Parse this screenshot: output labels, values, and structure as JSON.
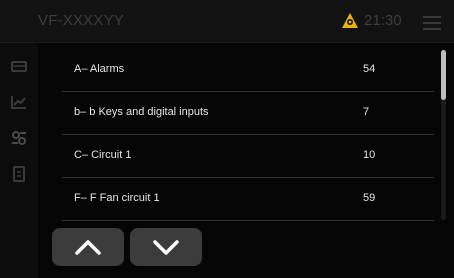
{
  "header": {
    "title": "VF-XXXXYY",
    "time": "21:30"
  },
  "icons": {
    "alarm": "alarm-warning-icon",
    "menu": "hamburger-menu-icon",
    "sidebar": [
      "monitor-icon",
      "chart-icon",
      "settings-icon",
      "document-icon"
    ],
    "up": "chevron-up-icon",
    "down": "chevron-down-icon"
  },
  "colors": {
    "alarm": "#e6b400",
    "text": "#e6e6e6",
    "button": "#3c3c3c"
  },
  "list": {
    "items": [
      {
        "label": "A– Alarms",
        "count": "54"
      },
      {
        "label": "b– b Keys and digital inputs",
        "count": "7"
      },
      {
        "label": "C– Circuit 1",
        "count": "10"
      },
      {
        "label": "F– F Fan circuit 1",
        "count": "59"
      }
    ]
  }
}
